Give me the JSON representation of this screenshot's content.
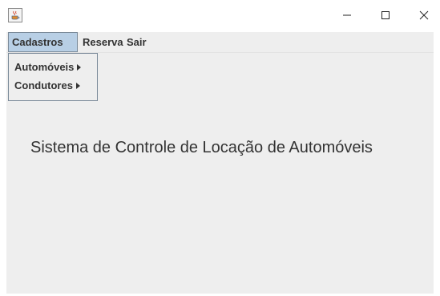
{
  "titlebar": {
    "title": "",
    "icons": {
      "app": "java-coffee-cup-icon",
      "minimize": "minimize-icon",
      "maximize": "maximize-icon",
      "close": "close-icon"
    }
  },
  "menubar": {
    "menus": [
      {
        "label": "Cadastros",
        "selected": true
      },
      {
        "label": "Reserva",
        "selected": false
      },
      {
        "label": "Sair",
        "selected": false
      }
    ]
  },
  "dropdown": {
    "items": [
      {
        "label": "Automóveis",
        "has_submenu": true
      },
      {
        "label": "Condutores",
        "has_submenu": true
      }
    ]
  },
  "main": {
    "heading": "Sistema de Controle de Locação de Automóveis"
  },
  "colors": {
    "content_background": "#eeeeee",
    "selected_menu_background": "#b8cfe5",
    "menu_border": "#7a8a99",
    "text": "#333333"
  }
}
